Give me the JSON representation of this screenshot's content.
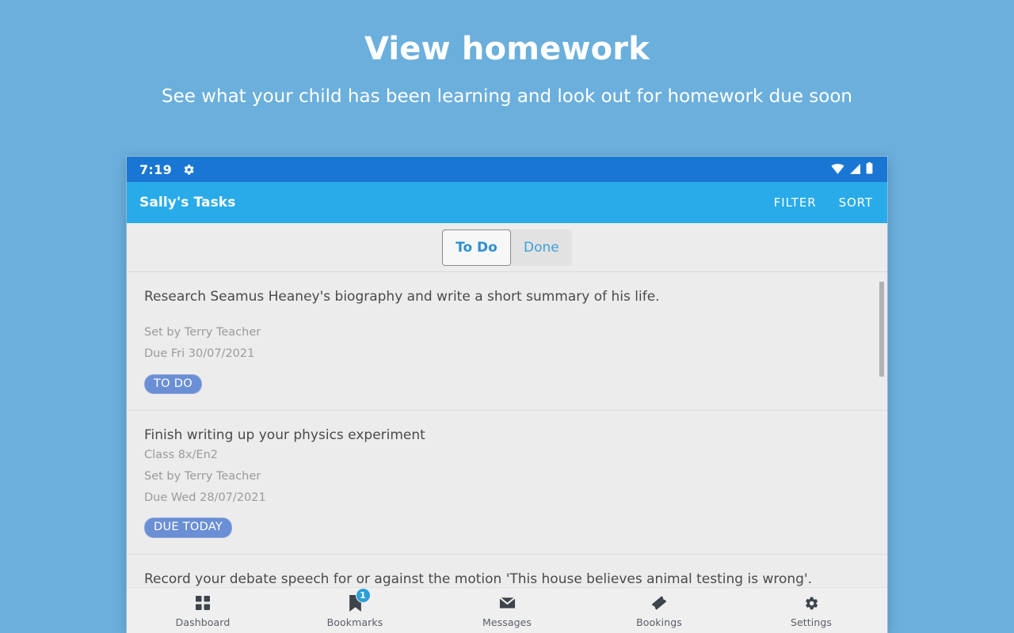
{
  "promo": {
    "title": "View homework",
    "subtitle": "See what your child has been learning and look out for homework due soon"
  },
  "phone": {
    "statusbar": {
      "clock": "7:19",
      "gear_icon": "gear-icon",
      "wifi_icon": "wifi-icon",
      "signal_icon": "signal-icon",
      "battery_icon": "battery-icon"
    },
    "appbar": {
      "title": "Sally's Tasks",
      "filter_label": "FILTER",
      "sort_label": "SORT",
      "background_color": "#29ABE9"
    },
    "tabs": [
      {
        "label": "To Do",
        "selected": true
      },
      {
        "label": "Done",
        "selected": false
      }
    ],
    "tasks": [
      {
        "title": "Research Seamus Heaney's biography and write a short summary of his life.",
        "class": "",
        "set_by": "Set by Terry Teacher",
        "due": "Due Fri 30/07/2021",
        "badge": "TO DO",
        "badge_color": "#6b8fd4"
      },
      {
        "title": "Finish writing up your physics experiment",
        "class": "Class 8x/En2",
        "set_by": "Set by Terry Teacher",
        "due": "Due Wed 28/07/2021",
        "badge": "DUE TODAY",
        "badge_color": "#6b8fd4"
      },
      {
        "title": "Record your debate speech for or against the motion 'This house believes animal testing is wrong'.",
        "class": "",
        "set_by": "",
        "due": "",
        "badge": "",
        "badge_color": ""
      }
    ],
    "bottom_nav": [
      {
        "label": "Dashboard",
        "icon": "dashboard-grid-icon",
        "badge": ""
      },
      {
        "label": "Bookmarks",
        "icon": "bookmark-icon",
        "badge": "1"
      },
      {
        "label": "Messages",
        "icon": "envelope-icon",
        "badge": ""
      },
      {
        "label": "Bookings",
        "icon": "ticket-icon",
        "badge": ""
      },
      {
        "label": "Settings",
        "icon": "gear-icon",
        "badge": ""
      }
    ]
  }
}
